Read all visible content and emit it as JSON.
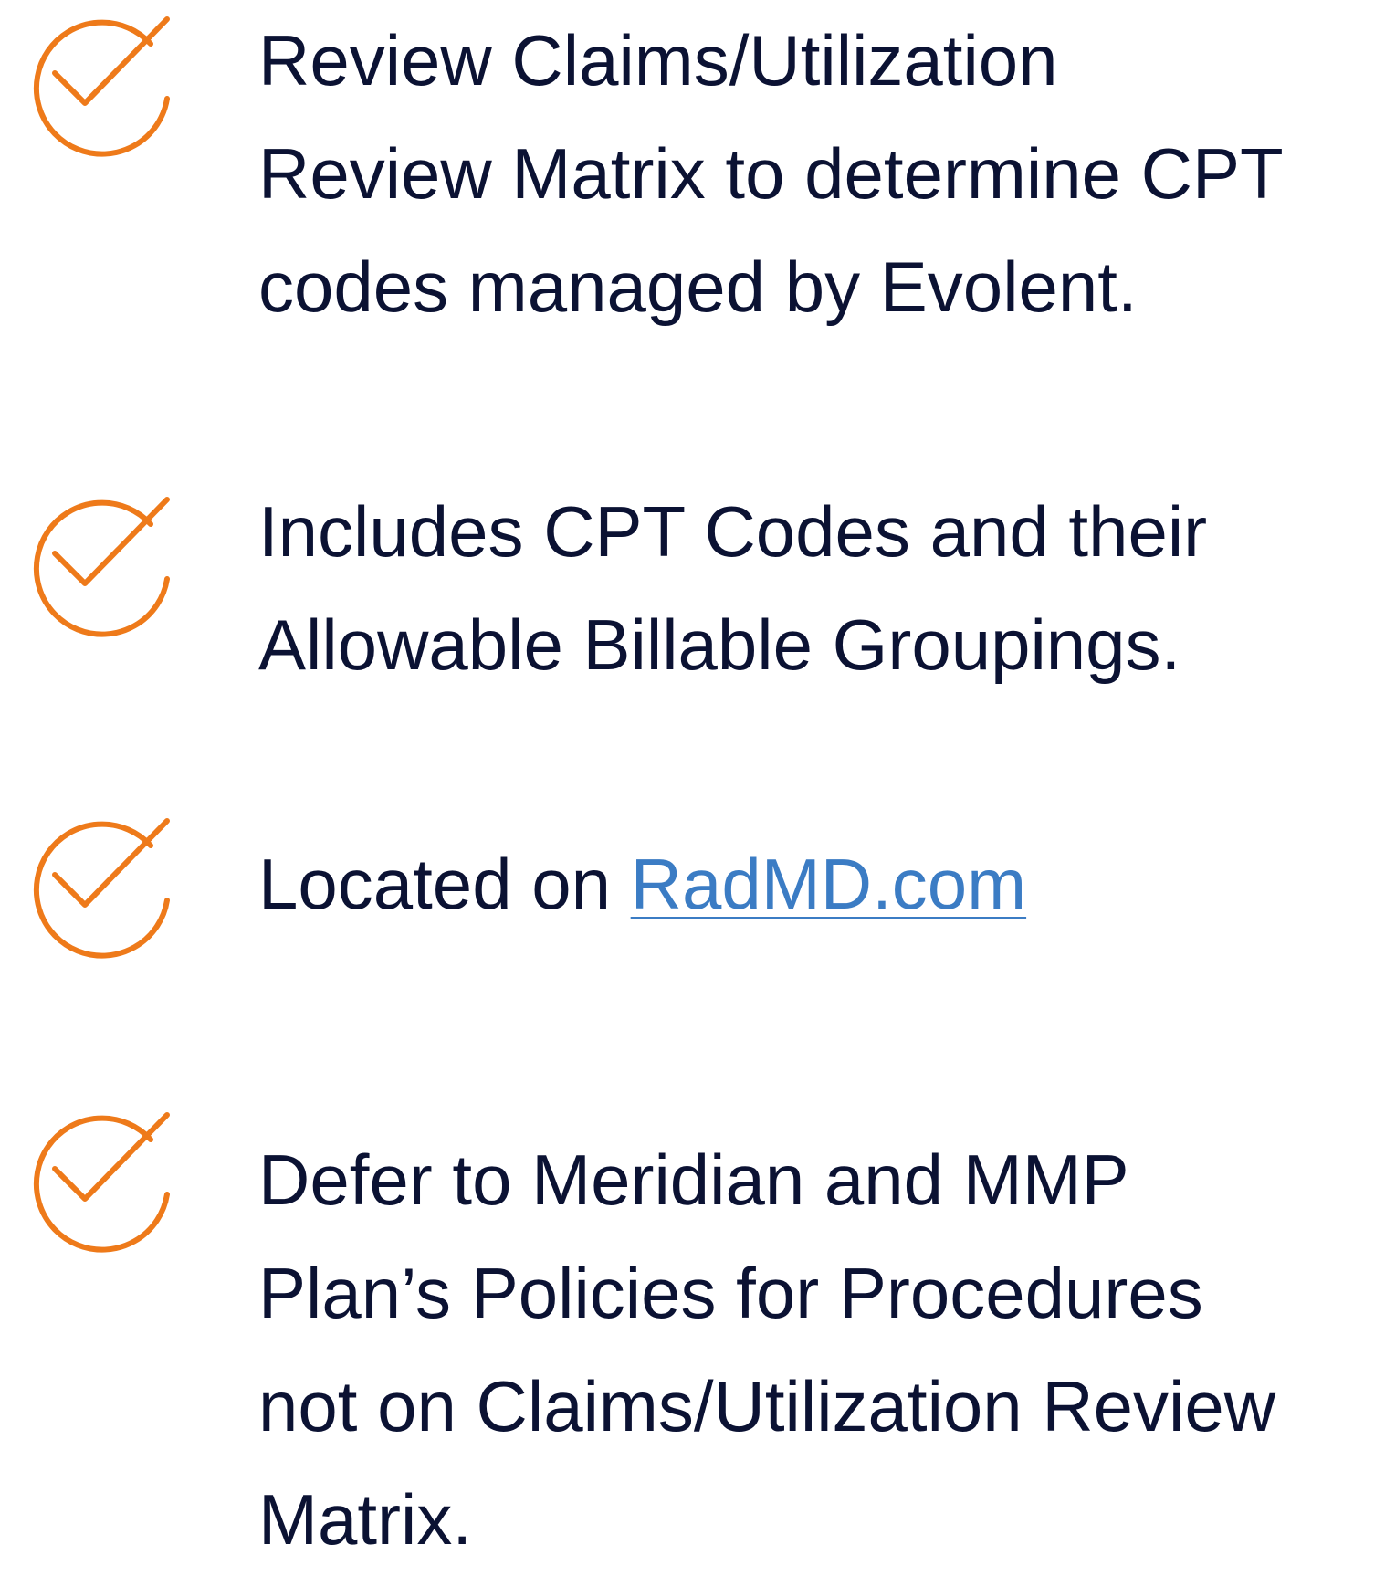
{
  "colors": {
    "text": "#0b1233",
    "accent_orange": "#ee7a1a",
    "link": "#3b7cc4",
    "background": "#ffffff"
  },
  "icons": {
    "bullet": "check-circle-icon"
  },
  "items": [
    {
      "lines": [
        "Review Claims/Utilization",
        "Review Matrix to determine CPT",
        "codes managed by Evolent."
      ]
    },
    {
      "lines": [
        "Includes CPT Codes and their",
        "Allowable Billable Groupings."
      ]
    },
    {
      "prefix": "Located on ",
      "link_text": "RadMD.com"
    },
    {
      "lines": [
        "Defer to Meridian and MMP",
        "Plan’s Policies for Procedures",
        "not on Claims/Utilization Review",
        "Matrix."
      ]
    }
  ]
}
